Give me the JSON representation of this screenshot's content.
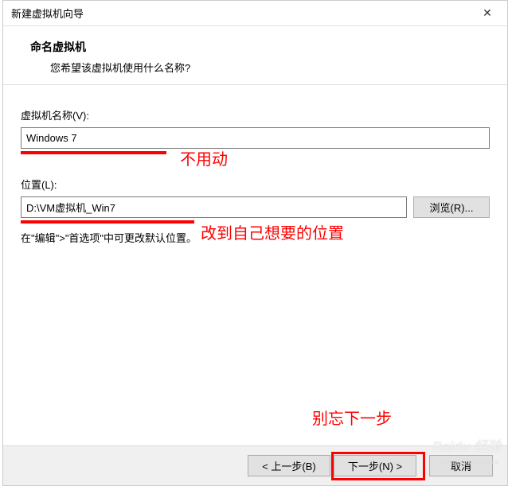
{
  "window": {
    "title": "新建虚拟机向导",
    "close_symbol": "✕"
  },
  "header": {
    "title": "命名虚拟机",
    "subtitle": "您希望该虚拟机使用什么名称?"
  },
  "fields": {
    "name_label": "虚拟机名称(V):",
    "name_value": "Windows 7",
    "location_label": "位置(L):",
    "location_value": "D:\\VM虚拟机_Win7",
    "browse_label": "浏览(R)..."
  },
  "hint": "在\"编辑\">\"首选项\"中可更改默认位置。",
  "annotations": {
    "name_note": "不用动",
    "location_note": "改到自己想要的位置",
    "next_note": "别忘下一步"
  },
  "buttons": {
    "back": "< 上一步(B)",
    "next": "下一步(N) >",
    "cancel": "取消"
  },
  "watermark": {
    "main": "Baidu 经验",
    "sub": "jingyan.baidu.com"
  }
}
